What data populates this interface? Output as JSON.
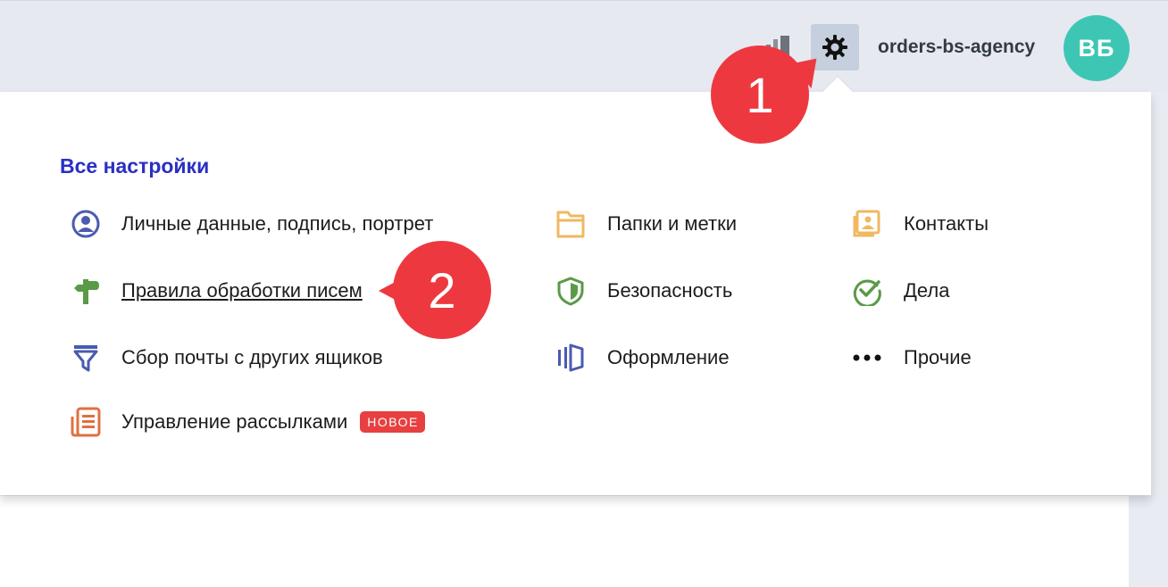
{
  "header": {
    "username": "orders-bs-agency",
    "avatar_initials": "ВБ",
    "avatar_color": "#3ec6b5"
  },
  "settings": {
    "title": "Все настройки",
    "items": [
      {
        "label": "Личные данные, подпись, портрет",
        "icon": "person-circle-icon"
      },
      {
        "label": "Правила обработки писем",
        "icon": "signpost-icon"
      },
      {
        "label": "Сбор почты с других ящиков",
        "icon": "funnel-icon"
      },
      {
        "label": "Управление рассылками",
        "icon": "newsletter-icon",
        "badge": "НОВОЕ"
      },
      {
        "label": "Папки и метки",
        "icon": "folder-icon"
      },
      {
        "label": "Безопасность",
        "icon": "shield-icon"
      },
      {
        "label": "Оформление",
        "icon": "theme-icon"
      },
      {
        "label": "Контакты",
        "icon": "contacts-icon"
      },
      {
        "label": "Дела",
        "icon": "check-circle-icon"
      },
      {
        "label": "Прочие",
        "icon": "more-dots-icon"
      }
    ]
  },
  "annotations": {
    "marker1": "1",
    "marker2": "2"
  },
  "colors": {
    "title": "#2a2fc4",
    "marker": "#ee3840",
    "badge": "#e84040"
  }
}
